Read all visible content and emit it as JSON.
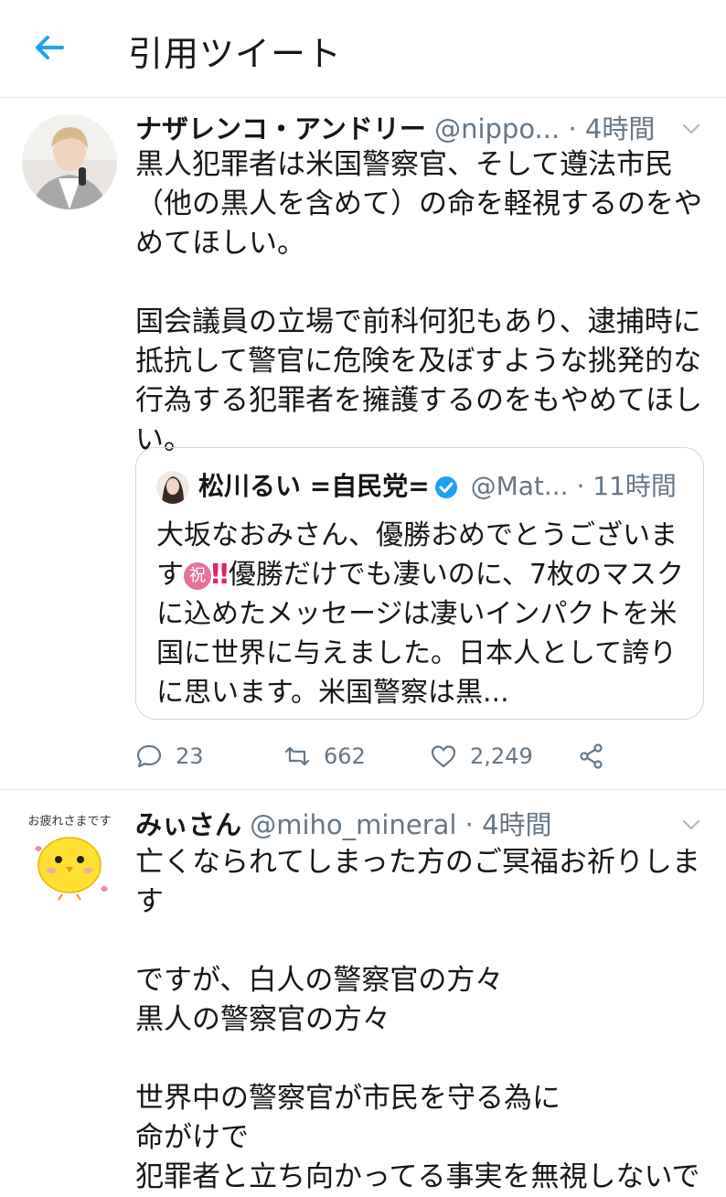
{
  "header": {
    "title": "引用ツイート",
    "back_icon": "back-arrow-icon"
  },
  "colors": {
    "accent": "#1da1f2",
    "text": "#14171a",
    "muted": "#657786",
    "border": "#e1e8ed"
  },
  "tweets": [
    {
      "name": "ナザレンコ・アンドリー",
      "handle": "@nippo...",
      "dot": "·",
      "time": "4時間",
      "text": "黒人犯罪者は米国警察官、そして遵法市民（他の黒人を含めて）の命を軽視するのをやめてほしい。\n\n国会議員の立場で前科何犯もあり、逮捕時に抵抗して警官に危険を及ぼすような挑発的な行為する犯罪者を擁護するのをもやめてほしい。",
      "quote": {
        "name": "松川るい =自民党=",
        "handle": "@Mat...",
        "dot": "·",
        "time": "11時間",
        "text_a": "大坂なおみさん、優勝おめでとうございます",
        "emoji_iwai": "祝",
        "emoji_bang": "‼",
        "text_b": "優勝だけでも凄いのに、7枚のマスクに込めたメッセージは凄いインパクトを米国に世界に与えました。日本人として誇りに思います。米国警察は黒..."
      },
      "actions": {
        "reply": "23",
        "retweet": "662",
        "like": "2,249"
      }
    },
    {
      "name": "みぃさん",
      "handle": "@miho_mineral",
      "dot": "·",
      "time": "4時間",
      "avatar_text": "お疲れさまです",
      "text": "亡くなられてしまった方のご冥福お祈りします\n\nですが、白人の警察官の方々\n黒人の警察官の方々\n\n世界中の警察官が市民を守る為に\n命がけで\n犯罪者と立ち向かってる事実を無視しないで"
    }
  ]
}
